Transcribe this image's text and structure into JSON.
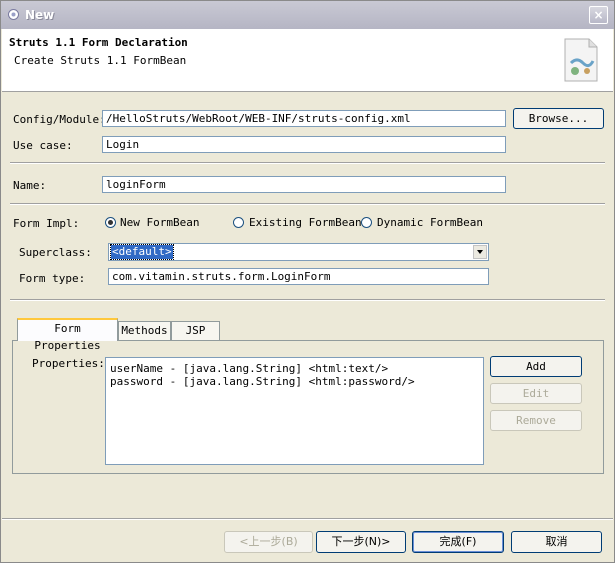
{
  "window": {
    "title": "New",
    "close_glyph": "×"
  },
  "header": {
    "title": "Struts 1.1 Form Declaration",
    "subtitle": "Create Struts 1.1 FormBean",
    "icon": "struts-form-wizard-icon"
  },
  "config": {
    "config_label": "Config/Module:",
    "config_value": "/HelloStruts/WebRoot/WEB-INF/struts-config.xml",
    "browse_label": "Browse...",
    "usecase_label": "Use case:",
    "usecase_value": "Login"
  },
  "name": {
    "label": "Name:",
    "value": "loginForm"
  },
  "form_impl": {
    "label": "Form Impl:",
    "options": [
      "New FormBean",
      "Existing FormBean",
      "Dynamic FormBean"
    ],
    "selected": "New FormBean"
  },
  "superclass": {
    "label": "Superclass:",
    "value": "<default>"
  },
  "form_type": {
    "label": "Form type:",
    "value": "com.vitamin.struts.form.LoginForm"
  },
  "tabs": [
    {
      "label": "Form Properties",
      "active": true
    },
    {
      "label": "Methods",
      "active": false
    },
    {
      "label": "JSP",
      "active": false
    }
  ],
  "properties": {
    "label": "Properties:",
    "items": [
      "userName - [java.lang.String] <html:text/>",
      "password - [java.lang.String] <html:password/>"
    ],
    "add_label": "Add",
    "edit_label": "Edit",
    "remove_label": "Remove"
  },
  "footer": {
    "back_label": "<上一步(B)",
    "next_label": "下一步(N)>",
    "finish_label": "完成(F)",
    "cancel_label": "取消"
  }
}
